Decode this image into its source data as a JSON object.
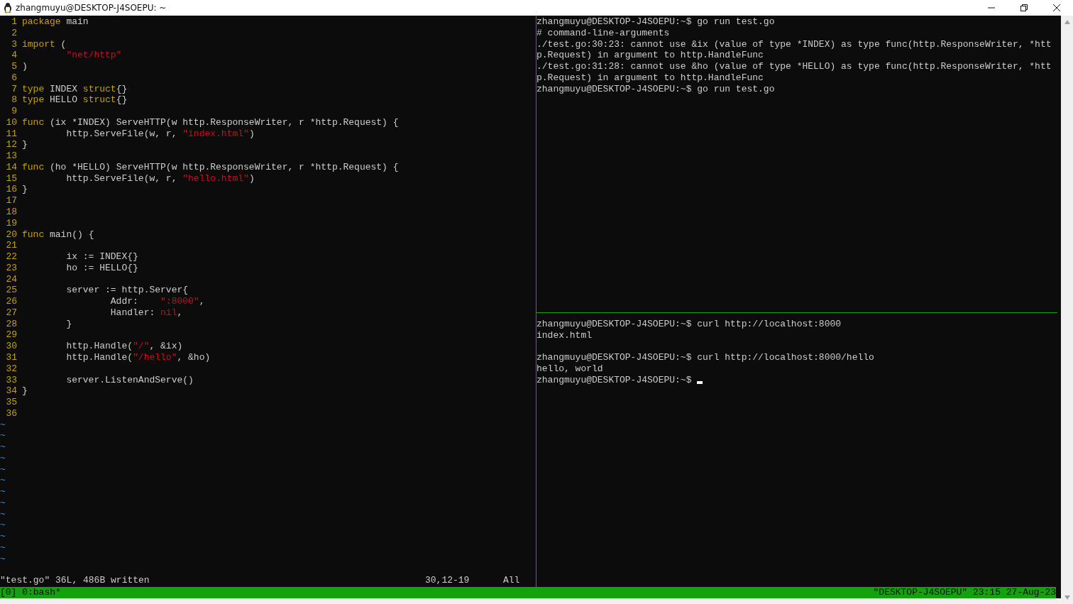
{
  "window": {
    "title": "zhangmuyu@DESKTOP-J4SOEPU: ~"
  },
  "editor": {
    "lines": [
      {
        "number": "1",
        "tokens": [
          {
            "kind": "keyword",
            "text": "package"
          },
          {
            "kind": "plain",
            "text": " main"
          }
        ]
      },
      {
        "number": "2"
      },
      {
        "number": "3",
        "tokens": [
          {
            "kind": "keyword",
            "text": "import"
          },
          {
            "kind": "plain",
            "text": " ("
          }
        ]
      },
      {
        "number": "4",
        "tokens": [
          {
            "kind": "string",
            "text": "        \"net/http\""
          }
        ]
      },
      {
        "number": "5",
        "tokens": [
          {
            "kind": "plain",
            "text": ")"
          }
        ]
      },
      {
        "number": "6"
      },
      {
        "number": "7",
        "tokens": [
          {
            "kind": "keyword",
            "text": "type"
          },
          {
            "kind": "plain",
            "text": " INDEX "
          },
          {
            "kind": "keyword",
            "text": "struct"
          },
          {
            "kind": "plain",
            "text": "{}"
          }
        ]
      },
      {
        "number": "8",
        "tokens": [
          {
            "kind": "keyword",
            "text": "type"
          },
          {
            "kind": "plain",
            "text": " HELLO "
          },
          {
            "kind": "keyword",
            "text": "struct"
          },
          {
            "kind": "plain",
            "text": "{}"
          }
        ]
      },
      {
        "number": "9"
      },
      {
        "number": "10",
        "tokens": [
          {
            "kind": "keyword",
            "text": "func"
          },
          {
            "kind": "plain",
            "text": " (ix *INDEX) ServeHTTP(w http.ResponseWriter, r *http.Request) {"
          }
        ]
      },
      {
        "number": "11",
        "tokens": [
          {
            "kind": "plain",
            "text": "        http.ServeFile(w, r, "
          },
          {
            "kind": "string",
            "text": "\"index.html\""
          },
          {
            "kind": "plain",
            "text": ")"
          }
        ]
      },
      {
        "number": "12",
        "tokens": [
          {
            "kind": "plain",
            "text": "}"
          }
        ]
      },
      {
        "number": "13"
      },
      {
        "number": "14",
        "tokens": [
          {
            "kind": "keyword",
            "text": "func"
          },
          {
            "kind": "plain",
            "text": " (ho *HELLO) ServeHTTP(w http.ResponseWriter, r *http.Request) {"
          }
        ]
      },
      {
        "number": "15",
        "tokens": [
          {
            "kind": "plain",
            "text": "        http.ServeFile(w, r, "
          },
          {
            "kind": "string",
            "text": "\"hello.html\""
          },
          {
            "kind": "plain",
            "text": ")"
          }
        ]
      },
      {
        "number": "16",
        "tokens": [
          {
            "kind": "plain",
            "text": "}"
          }
        ]
      },
      {
        "number": "17"
      },
      {
        "number": "18"
      },
      {
        "number": "19"
      },
      {
        "number": "20",
        "tokens": [
          {
            "kind": "keyword",
            "text": "func"
          },
          {
            "kind": "plain",
            "text": " main() {"
          }
        ]
      },
      {
        "number": "21"
      },
      {
        "number": "22",
        "tokens": [
          {
            "kind": "plain",
            "text": "        ix := INDEX{}"
          }
        ]
      },
      {
        "number": "23",
        "tokens": [
          {
            "kind": "plain",
            "text": "        ho := HELLO{}"
          }
        ]
      },
      {
        "number": "24"
      },
      {
        "number": "25",
        "tokens": [
          {
            "kind": "plain",
            "text": "        server := http.Server{"
          }
        ]
      },
      {
        "number": "26",
        "tokens": [
          {
            "kind": "plain",
            "text": "                Addr:    "
          },
          {
            "kind": "string",
            "text": "\":8000\""
          },
          {
            "kind": "plain",
            "text": ","
          }
        ]
      },
      {
        "number": "27",
        "tokens": [
          {
            "kind": "plain",
            "text": "                Handler: "
          },
          {
            "kind": "string",
            "text": "nil"
          },
          {
            "kind": "plain",
            "text": ","
          }
        ]
      },
      {
        "number": "28",
        "tokens": [
          {
            "kind": "plain",
            "text": "        }"
          }
        ]
      },
      {
        "number": "29"
      },
      {
        "number": "30",
        "tokens": [
          {
            "kind": "plain",
            "text": "        http.Handle("
          },
          {
            "kind": "string",
            "text": "\"/\""
          },
          {
            "kind": "plain",
            "text": ", &ix)"
          }
        ]
      },
      {
        "number": "31",
        "tokens": [
          {
            "kind": "plain",
            "text": "        http.Handle("
          },
          {
            "kind": "string",
            "text": "\"/hello\""
          },
          {
            "kind": "plain",
            "text": ", &ho)"
          }
        ]
      },
      {
        "number": "32"
      },
      {
        "number": "33",
        "tokens": [
          {
            "kind": "plain",
            "text": "        server.ListenAndServe()"
          }
        ]
      },
      {
        "number": "34",
        "tokens": [
          {
            "kind": "plain",
            "text": "}"
          }
        ]
      },
      {
        "number": "35"
      },
      {
        "number": "36"
      }
    ],
    "filler": [
      "~",
      "~",
      "~",
      "~",
      "~",
      "~",
      "~",
      "~",
      "~",
      "~",
      "~",
      "~",
      "~"
    ],
    "status": {
      "message": "\"test.go\" 36L, 486B written",
      "position": "30,12-19",
      "scroll": "All"
    }
  },
  "terminal_top": {
    "lines": [
      "zhangmuyu@DESKTOP-J4SOEPU:~$ go run test.go",
      "# command-line-arguments",
      "./test.go:30:23: cannot use &ix (value of type *INDEX) as type func(http.ResponseWriter, *htt",
      "p.Request) in argument to http.HandleFunc",
      "./test.go:31:28: cannot use &ho (value of type *HELLO) as type func(http.ResponseWriter, *htt",
      "p.Request) in argument to http.HandleFunc",
      "zhangmuyu@DESKTOP-J4SOEPU:~$ go run test.go"
    ]
  },
  "terminal_bottom": {
    "blocks": [
      [
        "zhangmuyu@DESKTOP-J4SOEPU:~$ curl http://localhost:8000",
        "index.html"
      ],
      [
        "zhangmuyu@DESKTOP-J4SOEPU:~$ curl http://localhost:8000/hello",
        "hello, world",
        "zhangmuyu@DESKTOP-J4SOEPU:~$"
      ]
    ]
  },
  "tmux_bar": {
    "left": "[0] 0:bash*",
    "right": "\"DESKTOP-J4SOEPU\" 23:15 27-Aug-23"
  }
}
